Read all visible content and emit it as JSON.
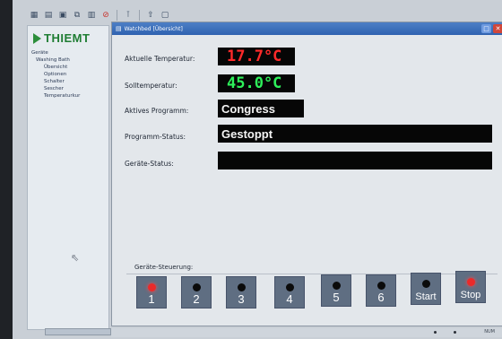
{
  "left_panel": {
    "logo_text": "THIEMT",
    "tree": [
      {
        "label": "Geräte",
        "level": 0
      },
      {
        "label": "Washing Bath",
        "level": 1
      },
      {
        "label": "Übersicht",
        "level": 2
      },
      {
        "label": "Optionen",
        "level": 2
      },
      {
        "label": "Schalter",
        "level": 2
      },
      {
        "label": "Sescher",
        "level": 2
      },
      {
        "label": "Temperaturkur",
        "level": 2
      }
    ]
  },
  "window": {
    "title": "Watchbed [Übersicht]",
    "rows": {
      "current_temp_label": "Aktuelle Temperatur:",
      "current_temp_value": "17.7°C",
      "target_temp_label": "Solltemperatur:",
      "target_temp_value": "45.0°C",
      "active_program_label": "Aktives Programm:",
      "active_program_value": "Congress",
      "program_status_label": "Programm-Status:",
      "program_status_value": "Gestoppt",
      "device_status_label": "Geräte-Status:",
      "device_status_value": ""
    },
    "control": {
      "label": "Geräte-Steuerung:",
      "buttons": [
        {
          "label": "1",
          "led": "red"
        },
        {
          "label": "2",
          "led": "black"
        },
        {
          "label": "3",
          "led": "black"
        },
        {
          "label": "4",
          "led": "black"
        },
        {
          "label": "5",
          "led": "black"
        },
        {
          "label": "6",
          "led": "black"
        },
        {
          "label": "Start",
          "led": "black"
        },
        {
          "label": "Stop",
          "led": "red"
        }
      ]
    }
  },
  "status_bar": {
    "text": "NUM"
  },
  "colors": {
    "brand_green": "#1f7d33",
    "led_red": "#ea2a2a",
    "seg_red": "#ff2a2a",
    "seg_green": "#2ef05a",
    "button_gray": "#5f6e82"
  }
}
